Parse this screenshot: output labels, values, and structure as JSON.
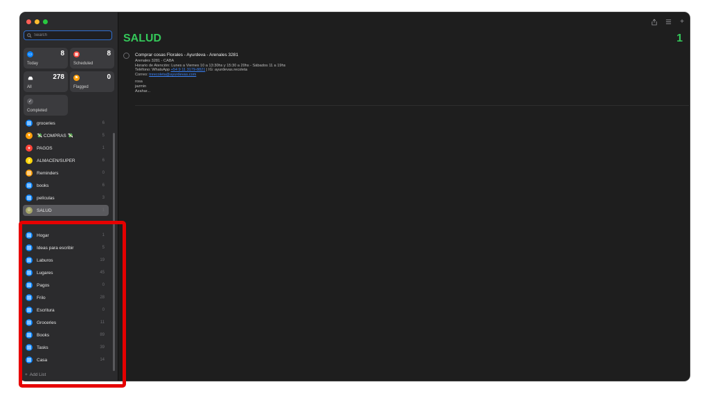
{
  "search": {
    "placeholder": "Search"
  },
  "smart_lists": [
    {
      "key": "today",
      "label": "Today",
      "count": "8",
      "color": "#0a84ff"
    },
    {
      "key": "scheduled",
      "label": "Scheduled",
      "count": "8",
      "color": "#ff453a"
    },
    {
      "key": "all",
      "label": "All",
      "count": "278",
      "color": "#3b3b3e"
    },
    {
      "key": "flagged",
      "label": "Flagged",
      "count": "0",
      "color": "#ff9f0a"
    },
    {
      "key": "completed",
      "label": "Completed",
      "count": "",
      "color": "#5a5a5e"
    }
  ],
  "lists": [
    {
      "name": "groceries",
      "count": "6",
      "color": "#0a84ff",
      "icon": "list-icon"
    },
    {
      "name": "💸 COMPRAS 💸",
      "count": "5",
      "color": "#ff9f0a",
      "icon": "heart-icon"
    },
    {
      "name": "PAGOS",
      "count": "1",
      "color": "#ff453a",
      "icon": "running-icon"
    },
    {
      "name": "ALMACEN/SUPER",
      "count": "6",
      "color": "#ffd60a",
      "icon": "key-icon"
    },
    {
      "name": "Reminders",
      "count": "0",
      "color": "#ff9f0a",
      "icon": "list-icon"
    },
    {
      "name": "books",
      "count": "6",
      "color": "#0a84ff",
      "icon": "list-icon"
    },
    {
      "name": "películas",
      "count": "3",
      "color": "#0a84ff",
      "icon": "list-icon"
    },
    {
      "name": "SALUD",
      "count": "1",
      "color": "#a8a86a",
      "icon": "smile-icon",
      "selected": true
    },
    {
      "name": "Hogar",
      "count": "1",
      "color": "#0a84ff",
      "icon": "list-icon"
    },
    {
      "name": "Ideas para escribir",
      "count": "5",
      "color": "#0a84ff",
      "icon": "list-icon"
    },
    {
      "name": "Laburos",
      "count": "19",
      "color": "#0a84ff",
      "icon": "list-icon"
    },
    {
      "name": "Lugares",
      "count": "45",
      "color": "#0a84ff",
      "icon": "list-icon"
    },
    {
      "name": "Pagos",
      "count": "0",
      "color": "#0a84ff",
      "icon": "list-icon"
    },
    {
      "name": "Frilo",
      "count": "28",
      "color": "#0a84ff",
      "icon": "list-icon"
    },
    {
      "name": "Escritura",
      "count": "0",
      "color": "#0a84ff",
      "icon": "list-icon"
    },
    {
      "name": "Groceries",
      "count": "11",
      "color": "#0a84ff",
      "icon": "list-icon"
    },
    {
      "name": "Books",
      "count": "89",
      "color": "#0a84ff",
      "icon": "list-icon"
    },
    {
      "name": "Tasks",
      "count": "39",
      "color": "#0a84ff",
      "icon": "list-icon"
    },
    {
      "name": "Casa",
      "count": "14",
      "color": "#0a84ff",
      "icon": "list-icon"
    }
  ],
  "add_list_label": "Add List",
  "main": {
    "title": "SALUD",
    "count": "1",
    "reminder": {
      "title": "Comprar cosas Florales - Ayurdeva - Arenales 3281",
      "notes": {
        "line1": "Arenales 3281 - CABA",
        "line2": "Horario de Atención: Lunes a Viernes 10 a 13:30hs y 15:30 a 20hs - Sábados 11 a 19hs",
        "line3_prefix": "Teléfono: WhatsApp ",
        "line3_link": "+54 9 11 3179-8821",
        "line3_suffix": " | IG: ayurdevas.recoleta",
        "line4_prefix": "Correo: ",
        "line4_link": "tnrecoleta@ayurdevas.com",
        "line5": "rosa",
        "line6": "jazmin",
        "line7": "Azahar..."
      }
    }
  },
  "colors": {
    "accent_green": "#34c759",
    "highlight_red": "#e60000"
  }
}
